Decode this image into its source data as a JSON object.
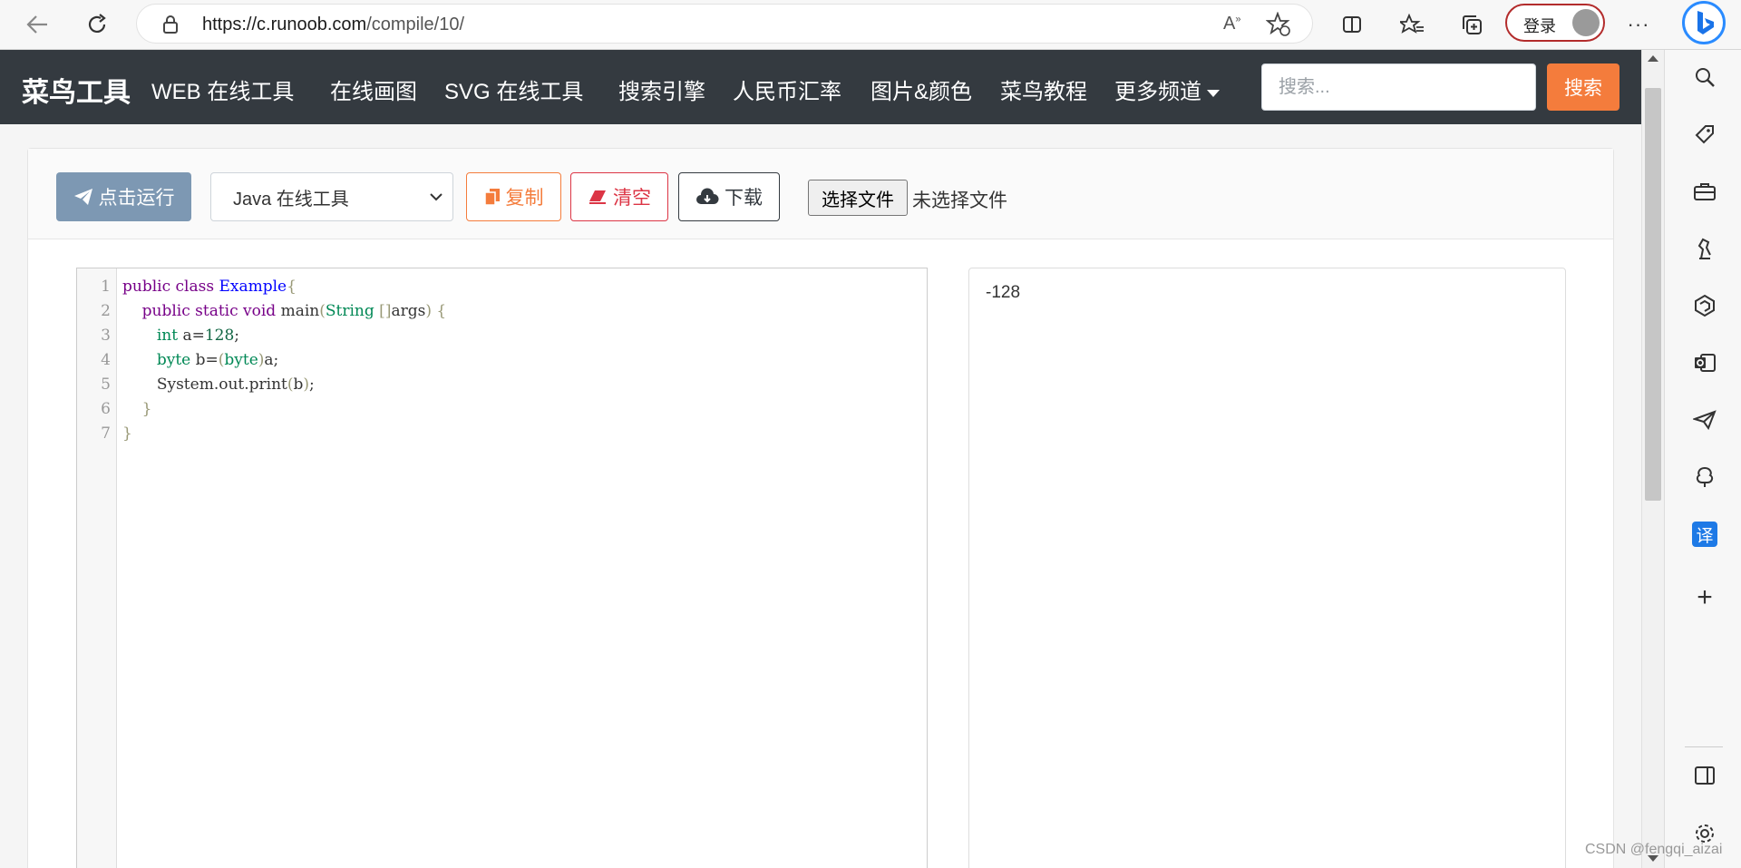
{
  "browser": {
    "url_host": "https://c.runoob.com",
    "url_path": "/compile/10/",
    "login_label": "登录"
  },
  "nav": {
    "brand": "菜鸟工具",
    "links": [
      "WEB 在线工具",
      "在线画图",
      "SVG 在线工具",
      "搜索引擎",
      "人民币汇率",
      "图片&颜色",
      "菜鸟教程",
      "更多频道"
    ],
    "search_placeholder": "搜索...",
    "search_button": "搜索"
  },
  "toolbar": {
    "run_label": "点击运行",
    "language_selected": "Java 在线工具",
    "copy_label": "复制",
    "clear_label": "清空",
    "download_label": "下载",
    "file_button": "选择文件",
    "file_status": "未选择文件"
  },
  "editor": {
    "line_numbers": [
      "1",
      "2",
      "3",
      "4",
      "5",
      "6",
      "7"
    ],
    "lines": [
      "public class Example{",
      "    public static void main(String []args) {",
      "       int a=128;",
      "       byte b=(byte)a;",
      "       System.out.print(b);",
      "    }",
      "}"
    ]
  },
  "output": {
    "text": "-128"
  },
  "watermark": "CSDN @fengqi_aizai",
  "colors": {
    "navbar": "#343a40",
    "accent": "#f47c3c",
    "danger": "#dc3545",
    "run_button": "#7d98b3"
  }
}
